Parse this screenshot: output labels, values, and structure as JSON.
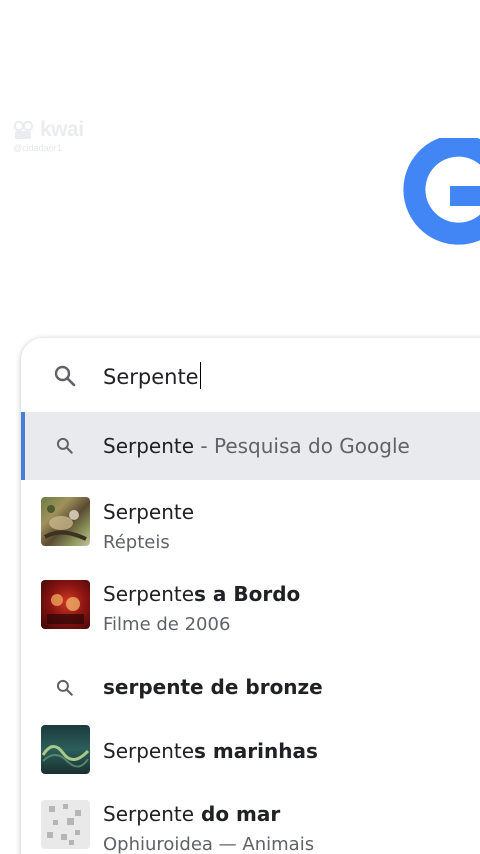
{
  "watermark": {
    "brand": "kwai",
    "handle": "@cidadaor1"
  },
  "search": {
    "query": "Serpente"
  },
  "suggestions": [
    {
      "type": "query",
      "main": "Serpente",
      "sep": " - ",
      "sub": "Pesquisa do Google",
      "highlighted": true
    },
    {
      "type": "entity",
      "main": "Serpente",
      "sub": "Répteis",
      "icon": "reptile-thumbnail"
    },
    {
      "type": "entity",
      "main_plain": "Serpente",
      "main_bold": "s a Bordo",
      "sub": "Filme de 2006",
      "icon": "movie-poster-thumbnail"
    },
    {
      "type": "query",
      "main_plain": "serpente",
      "main_bold": " de bronze"
    },
    {
      "type": "entity",
      "main_plain": "Serpente",
      "main_bold": "s marinhas",
      "icon": "sea-snake-thumbnail"
    },
    {
      "type": "entity",
      "main_plain": "Serpente",
      "main_bold": " do mar",
      "sub": "Ophiuroidea — Animais",
      "icon": "ophiuroidea-thumbnail"
    }
  ],
  "colors": {
    "google_blue": "#4285f4",
    "highlight_bg": "#e8eaed",
    "accent_bar": "#4a7fd6"
  }
}
